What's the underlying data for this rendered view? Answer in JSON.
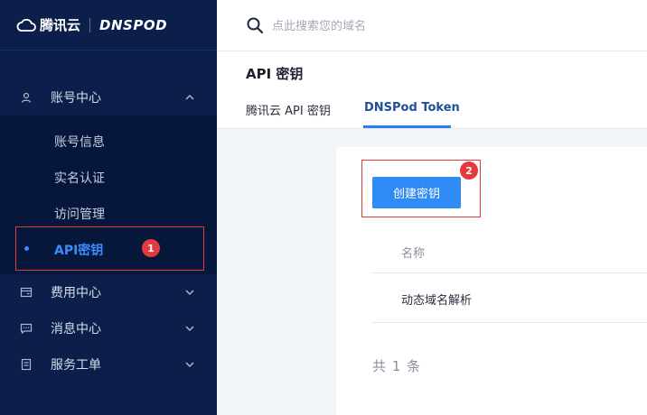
{
  "logo": {
    "brand": "腾讯云",
    "product": "DNSPOD"
  },
  "search": {
    "placeholder": "点此搜索您的域名"
  },
  "sidebar": {
    "groups": [
      {
        "label": "账号中心",
        "icon": "user-icon",
        "expanded": true
      },
      {
        "label": "费用中心",
        "icon": "wallet-icon",
        "expanded": false
      },
      {
        "label": "消息中心",
        "icon": "message-icon",
        "expanded": false
      },
      {
        "label": "服务工单",
        "icon": "ticket-icon",
        "expanded": false
      }
    ],
    "account_items": [
      "账号信息",
      "实名认证",
      "访问管理",
      "API密钥"
    ],
    "active_item": "API密钥"
  },
  "annotations": {
    "badge1": "1",
    "badge2": "2"
  },
  "page": {
    "title": "API 密钥",
    "tabs": [
      {
        "label": "腾讯云 API 密钥",
        "active": false
      },
      {
        "label": "DNSPod Token",
        "active": true
      }
    ]
  },
  "content": {
    "create_button": "创建密钥",
    "columns": [
      "名称"
    ],
    "rows": [
      [
        "动态域名解析"
      ]
    ],
    "total_text": "共 1 条"
  },
  "colors": {
    "sidebar": "#0b1f4a",
    "accent": "#2f8cf5",
    "highlight": "#e23b3b"
  }
}
